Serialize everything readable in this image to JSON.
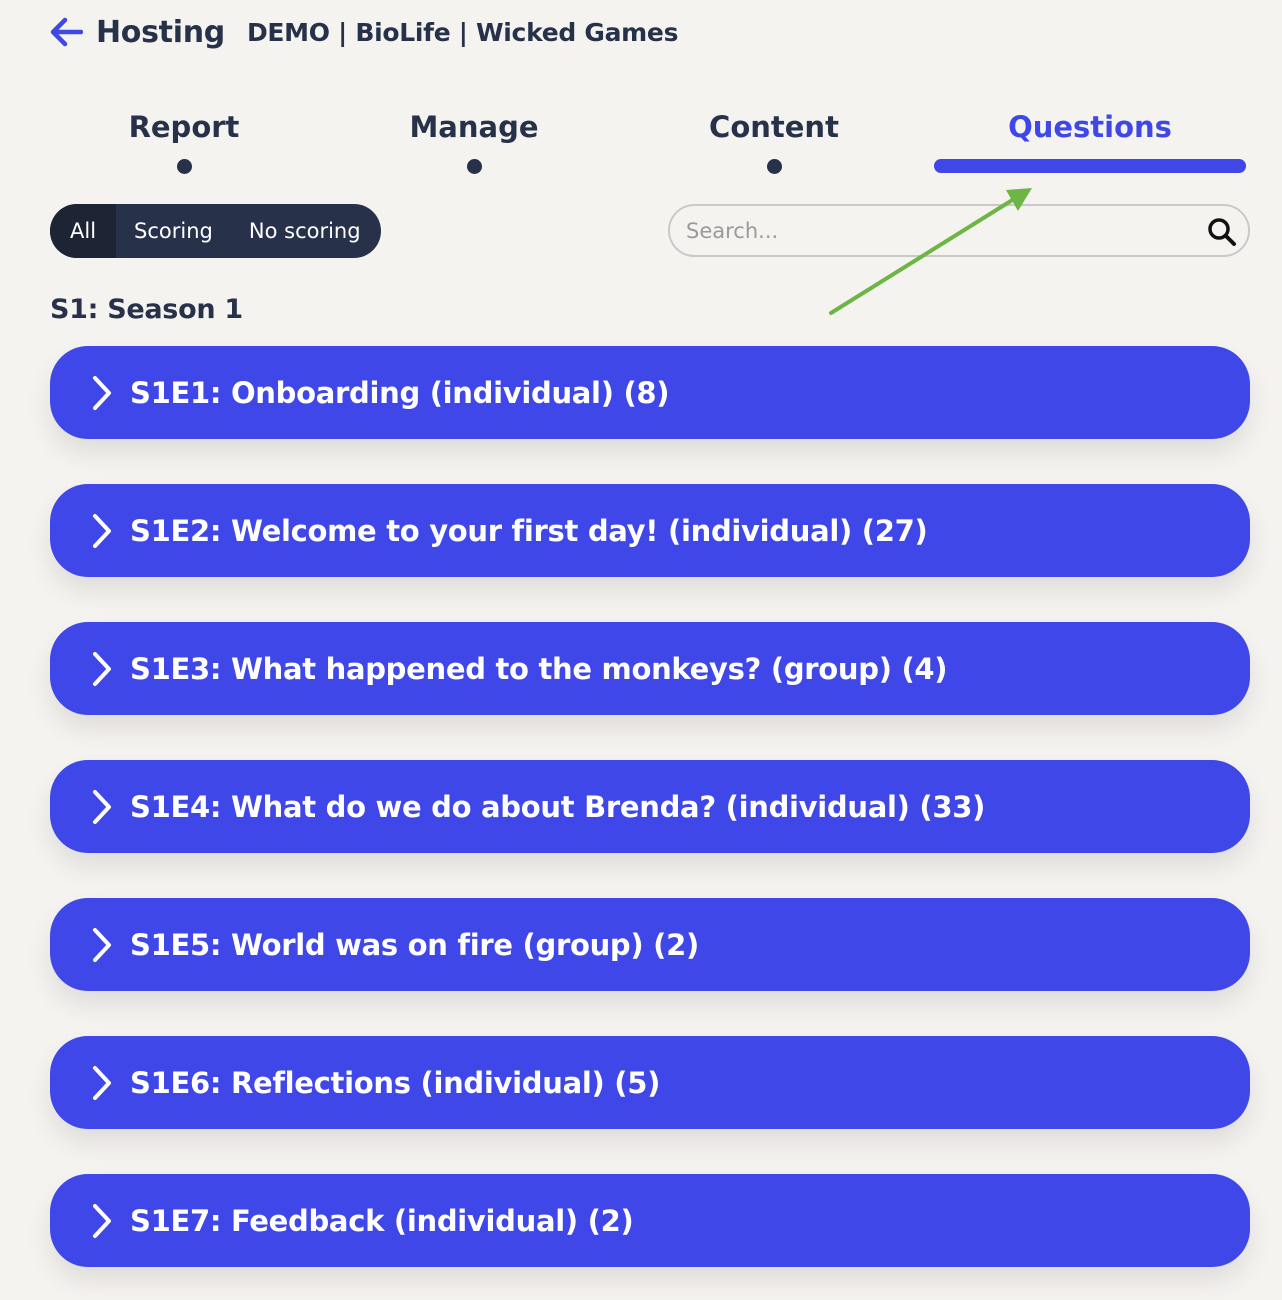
{
  "header": {
    "title": "Hosting",
    "subtitle": "DEMO | BioLife | Wicked Games"
  },
  "tabs": [
    {
      "label": "Report",
      "active": false
    },
    {
      "label": "Manage",
      "active": false
    },
    {
      "label": "Content",
      "active": false
    },
    {
      "label": "Questions",
      "active": true
    }
  ],
  "filters": [
    {
      "label": "All",
      "active": true
    },
    {
      "label": "Scoring",
      "active": false
    },
    {
      "label": "No scoring",
      "active": false
    }
  ],
  "search": {
    "placeholder": "Search...",
    "value": ""
  },
  "section": {
    "title": "S1: Season 1",
    "episodes": [
      {
        "label": "S1E1: Onboarding (individual) (8)"
      },
      {
        "label": "S1E2: Welcome to your first day! (individual) (27)"
      },
      {
        "label": "S1E3: What happened to the monkeys? (group) (4)"
      },
      {
        "label": "S1E4: What do we do about Brenda? (individual) (33)"
      },
      {
        "label": "S1E5: World was on fire (group) (2)"
      },
      {
        "label": "S1E6: Reflections (individual) (5)"
      },
      {
        "label": "S1E7: Feedback (individual) (2)"
      }
    ]
  },
  "colors": {
    "accent": "#3f47e8",
    "text": "#27324a",
    "background": "#f4f3f0",
    "annotation_arrow": "#6db544"
  },
  "icons": {
    "back": "arrow-left-icon",
    "search": "magnifier-icon",
    "expand": "chevron-right-icon"
  }
}
